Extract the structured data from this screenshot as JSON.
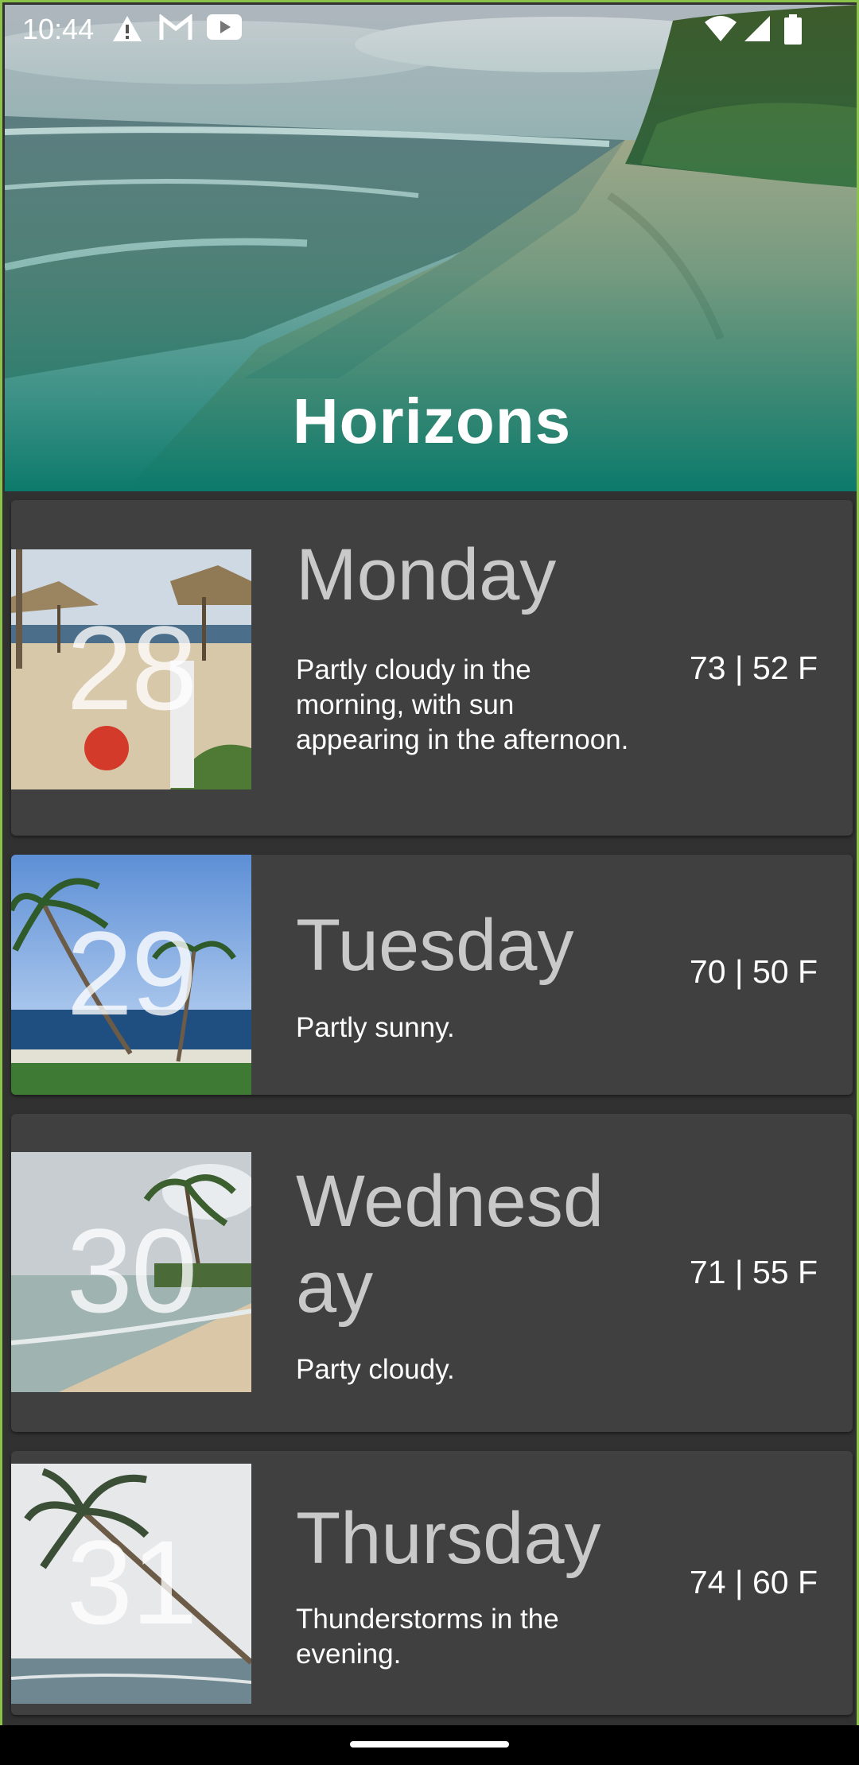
{
  "status_bar": {
    "time": "10:44",
    "icons": [
      "warning-icon",
      "gmail-icon",
      "youtube-icon",
      "wifi-icon",
      "signal-icon",
      "battery-icon"
    ]
  },
  "header": {
    "title": "Horizons"
  },
  "forecast": [
    {
      "date": "28",
      "day": "Monday",
      "description": "Partly cloudy in the morning, with sun appearing in the afternoon.",
      "temps": "73 | 52 F"
    },
    {
      "date": "29",
      "day": "Tuesday",
      "description": "Partly sunny.",
      "temps": "70 | 50 F"
    },
    {
      "date": "30",
      "day": "Wednesday",
      "description": "Party cloudy.",
      "temps": "71 | 55 F"
    },
    {
      "date": "31",
      "day": "Thursday",
      "description": "Thunderstorms in the evening.",
      "temps": "74 | 60 F"
    }
  ],
  "colors": {
    "accent_border": "#8bc34a",
    "card_background": "#404040",
    "app_background": "#313131",
    "header_gradient": "#0f7a6a"
  }
}
